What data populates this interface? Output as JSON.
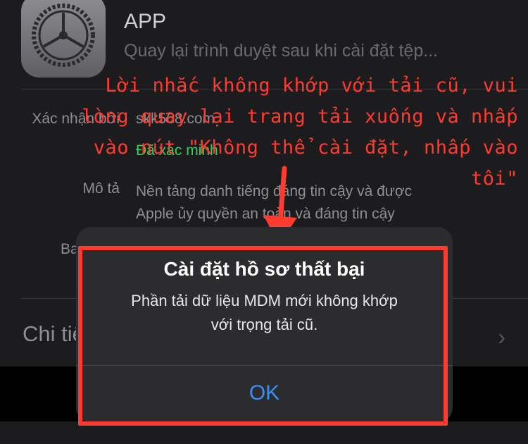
{
  "profile": {
    "app_name": "APP",
    "subtitle": "Quay lại trình duyệt sau khi cài đặt tệp...",
    "signed_by_label": "Xác nhận bởi",
    "signed_by_value": "skk568.com",
    "verified_text": "Đã xác minh",
    "description_label": "Mô tả",
    "description_lines": {
      "line1": "Nền tảng danh tiếng đáng tin cậy và được",
      "line2": "Apple ủy quyền an toàn và đáng tin cậy"
    },
    "contains_label": "Bao gồm",
    "details_label": "Chi tiết"
  },
  "annotation": {
    "color": "#ff3b30",
    "line1": "Lời nhắc không khớp với tải cũ, vui",
    "line2": "lòng quay lại trang tải xuống và nhấp",
    "line3": "vào nút \"Không thể cài đặt, nhấp vào",
    "line4": "tôi\""
  },
  "alert": {
    "title": "Cài đặt hồ sơ thất bại",
    "message_line1": "Phần tải dữ liệu MDM mới không khớp",
    "message_line2": "với trọng tải cũ.",
    "ok_label": "OK",
    "ok_color": "#3a8ef6"
  },
  "icons": {
    "app": "settings-gear-icon",
    "chevron": "chevron-right-icon",
    "arrow": "red-arrow-down-icon"
  }
}
